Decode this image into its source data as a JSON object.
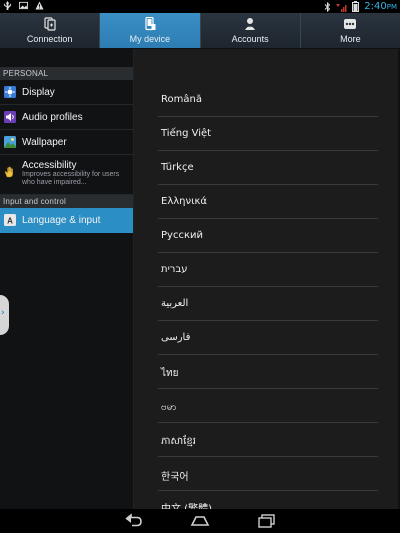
{
  "status_bar": {
    "time": "2:40",
    "time_suffix": "PM"
  },
  "tabs": [
    {
      "label": "Connection",
      "icon": "connection-icon"
    },
    {
      "label": "My device",
      "icon": "my-device-icon",
      "active": true
    },
    {
      "label": "Accounts",
      "icon": "accounts-icon"
    },
    {
      "label": "More",
      "icon": "more-icon"
    }
  ],
  "left_panel": {
    "section_personal": "PERSONAL",
    "items": [
      {
        "label": "Display",
        "icon": "display-icon"
      },
      {
        "label": "Audio profiles",
        "icon": "audio-icon"
      },
      {
        "label": "Wallpaper",
        "icon": "wallpaper-icon"
      },
      {
        "label": "Accessibility",
        "sub": "Improves accessibility for users who have impaired...",
        "icon": "hand-icon"
      }
    ],
    "section_input": "Input and control",
    "selected_item": {
      "label": "Language & input",
      "icon": "keyboard-icon"
    }
  },
  "languages": [
    "Română",
    "Tiếng Việt",
    "Türkçe",
    "Ελληνικά",
    "Русский",
    "עברית",
    "العربية",
    "فارسی",
    "ไทย",
    "ဗမာ",
    "ភាសាខ្មែរ",
    "한국어",
    "中文 (繁體)"
  ],
  "colors": {
    "accent": "#2b8ec4",
    "time": "#33b5e5"
  }
}
